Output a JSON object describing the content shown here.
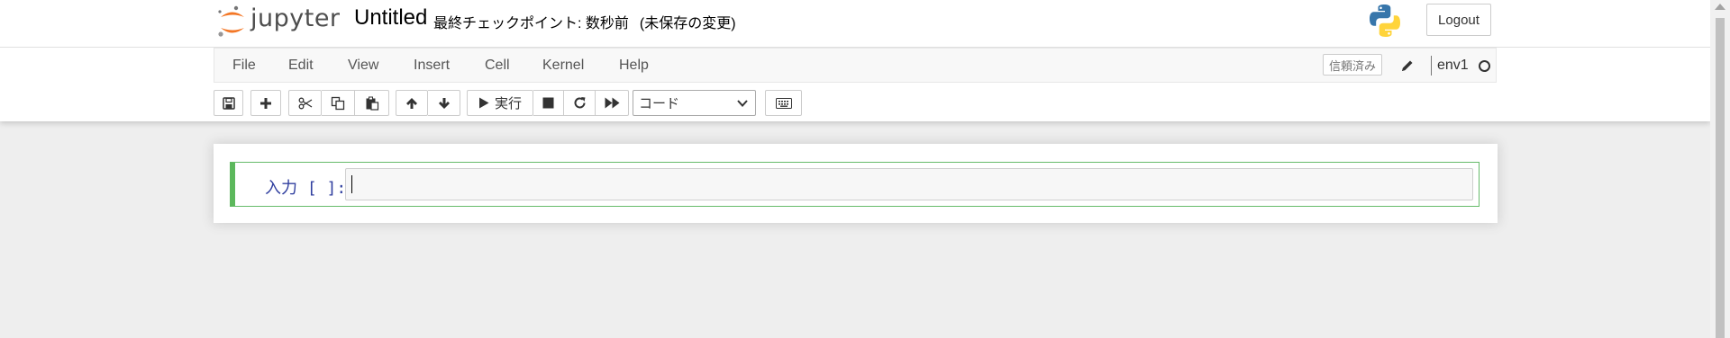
{
  "header": {
    "logo_text": "jupyter",
    "notebook_title": "Untitled",
    "checkpoint_label": "最終チェックポイント:",
    "checkpoint_time": "数秒前",
    "unsaved_status": "(未保存の変更)",
    "logout_label": "Logout"
  },
  "menubar": {
    "items": [
      "File",
      "Edit",
      "View",
      "Insert",
      "Cell",
      "Kernel",
      "Help"
    ],
    "trusted_label": "信頼済み",
    "kernel_name": "env1"
  },
  "toolbar": {
    "run_label": "実行",
    "cell_type": "コード",
    "icons": [
      "save-icon",
      "plus-icon",
      "cut-icon",
      "copy-icon",
      "paste-icon",
      "arrow-up-icon",
      "arrow-down-icon",
      "play-icon",
      "stop-icon",
      "restart-icon",
      "fast-forward-icon",
      "keyboard-icon"
    ]
  },
  "notebook": {
    "cells": [
      {
        "prompt": "入力 [ ]:",
        "source": ""
      }
    ]
  },
  "colors": {
    "accent_orange": "#f37726",
    "selected_cell_border": "#5cb85c",
    "prompt_blue": "#303f9f"
  }
}
